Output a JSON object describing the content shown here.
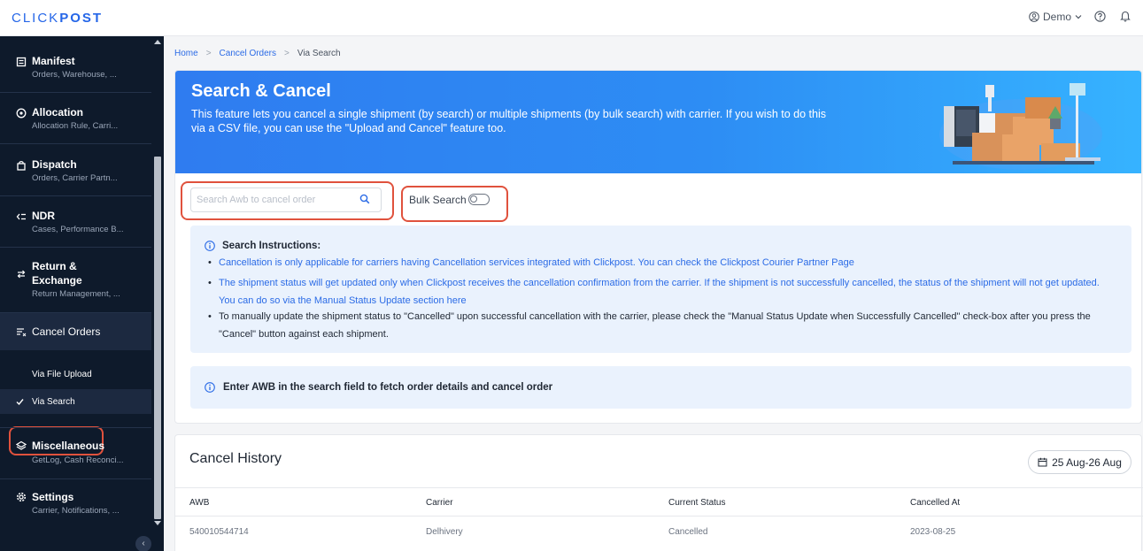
{
  "topbar": {
    "logo_a": "CLICK",
    "logo_b": "POST",
    "user": "Demo"
  },
  "sidebar": {
    "items": [
      {
        "title": "Manifest",
        "sub": "Orders, Warehouse, ..."
      },
      {
        "title": "Allocation",
        "sub": "Allocation Rule, Carri..."
      },
      {
        "title": "Dispatch",
        "sub": "Orders, Carrier Partn..."
      },
      {
        "title": "NDR",
        "sub": "Cases, Performance B..."
      },
      {
        "title": "Return &",
        "title2": "Exchange",
        "sub": "Return Management, ..."
      },
      {
        "title": "Cancel Orders"
      },
      {
        "title": "Miscellaneous",
        "sub": "GetLog, Cash Reconci..."
      },
      {
        "title": "Settings",
        "sub": "Carrier, Notifications, ..."
      }
    ],
    "cancel_sub": [
      "Via File Upload",
      "Via Search"
    ]
  },
  "breadcrumb": [
    "Home",
    "Cancel Orders",
    "Via Search"
  ],
  "banner": {
    "title": "Search & Cancel",
    "desc": "This feature lets you cancel a single shipment (by search) or multiple shipments (by bulk search) with carrier. If you wish to do this via a CSV file, you can use the \"Upload and Cancel\" feature too."
  },
  "search": {
    "placeholder": "Search Awb to cancel order",
    "bulk_label": "Bulk Search"
  },
  "instructions": {
    "heading": "Search Instructions:",
    "items": [
      "Cancellation is only applicable for carriers having Cancellation services integrated with Clickpost. You can check the Clickpost Courier Partner Page",
      "The shipment status will get updated only when Clickpost receives the cancellation confirmation from the carrier. If the shipment is not successfully cancelled, the status of the shipment will not get updated. You can do so via the Manual Status Update section here",
      "To manually update the shipment status to \"Cancelled\" upon successful cancellation with the carrier, please check the \"Manual Status Update when Successfully Cancelled\" check-box after you press the \"Cancel\" button against each shipment."
    ]
  },
  "notice": "Enter AWB in the search field to fetch order details and cancel order",
  "history": {
    "title": "Cancel History",
    "date_range": "25 Aug-26 Aug",
    "columns": [
      "AWB",
      "Carrier",
      "Current Status",
      "Cancelled At"
    ],
    "rows": [
      [
        "540010544714",
        "Delhivery",
        "Cancelled",
        "2023-08-25"
      ]
    ]
  },
  "colors": {
    "brand": "#2566e8",
    "annotation": "#e0523d",
    "sidebar": "#0e1a2b"
  }
}
